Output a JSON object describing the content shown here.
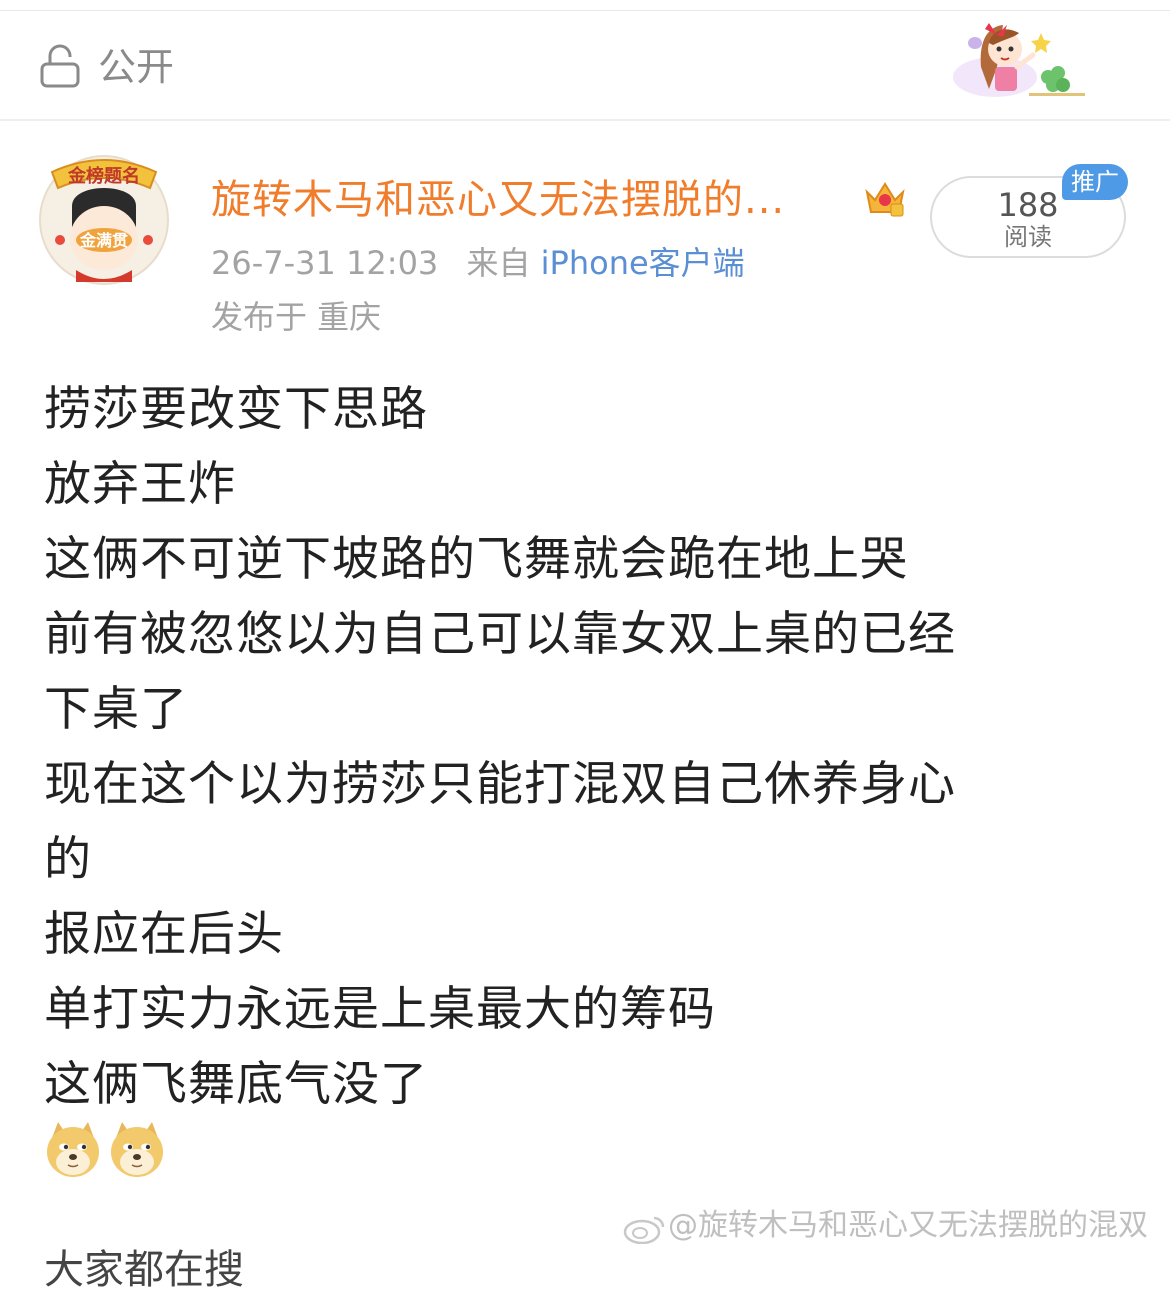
{
  "privacy": {
    "label": "公开",
    "icon": "lock-open-icon"
  },
  "author": {
    "name": "旋转木马和恶心又无法摆脱的...",
    "avatar_badge_text": "金榜题名",
    "avatar_label_text": "金满贯",
    "badge_icon": "crown-vip-icon"
  },
  "post_meta": {
    "datetime": "26-7-31 12:03",
    "source_prefix": "来自",
    "source_app": "iPhone客户端",
    "location": "发布于 重庆"
  },
  "reads": {
    "count": "188",
    "label": "阅读",
    "promo_badge": "推广"
  },
  "body_lines": [
    "捞莎要改变下思路",
    "放弃王炸",
    "这俩不可逆下坡路的飞舞就会跪在地上哭",
    "前有被忽悠以为自己可以靠女双上桌的已经",
    "下桌了",
    "现在这个以为捞莎只能打混双自己休养身心",
    "的",
    "报应在后头",
    "单打实力永远是上桌最大的筹码",
    "这俩飞舞底气没了"
  ],
  "emoji": [
    "doge-icon",
    "doge-icon"
  ],
  "watermark": "@旋转木马和恶心又无法摆脱的混双",
  "cut_off_text": "大家都在搜",
  "colors": {
    "username": "#f07d2c",
    "source_app": "#5b8fd3",
    "promo_badge": "#4e9ae6",
    "meta_text": "#a3a3a3"
  }
}
